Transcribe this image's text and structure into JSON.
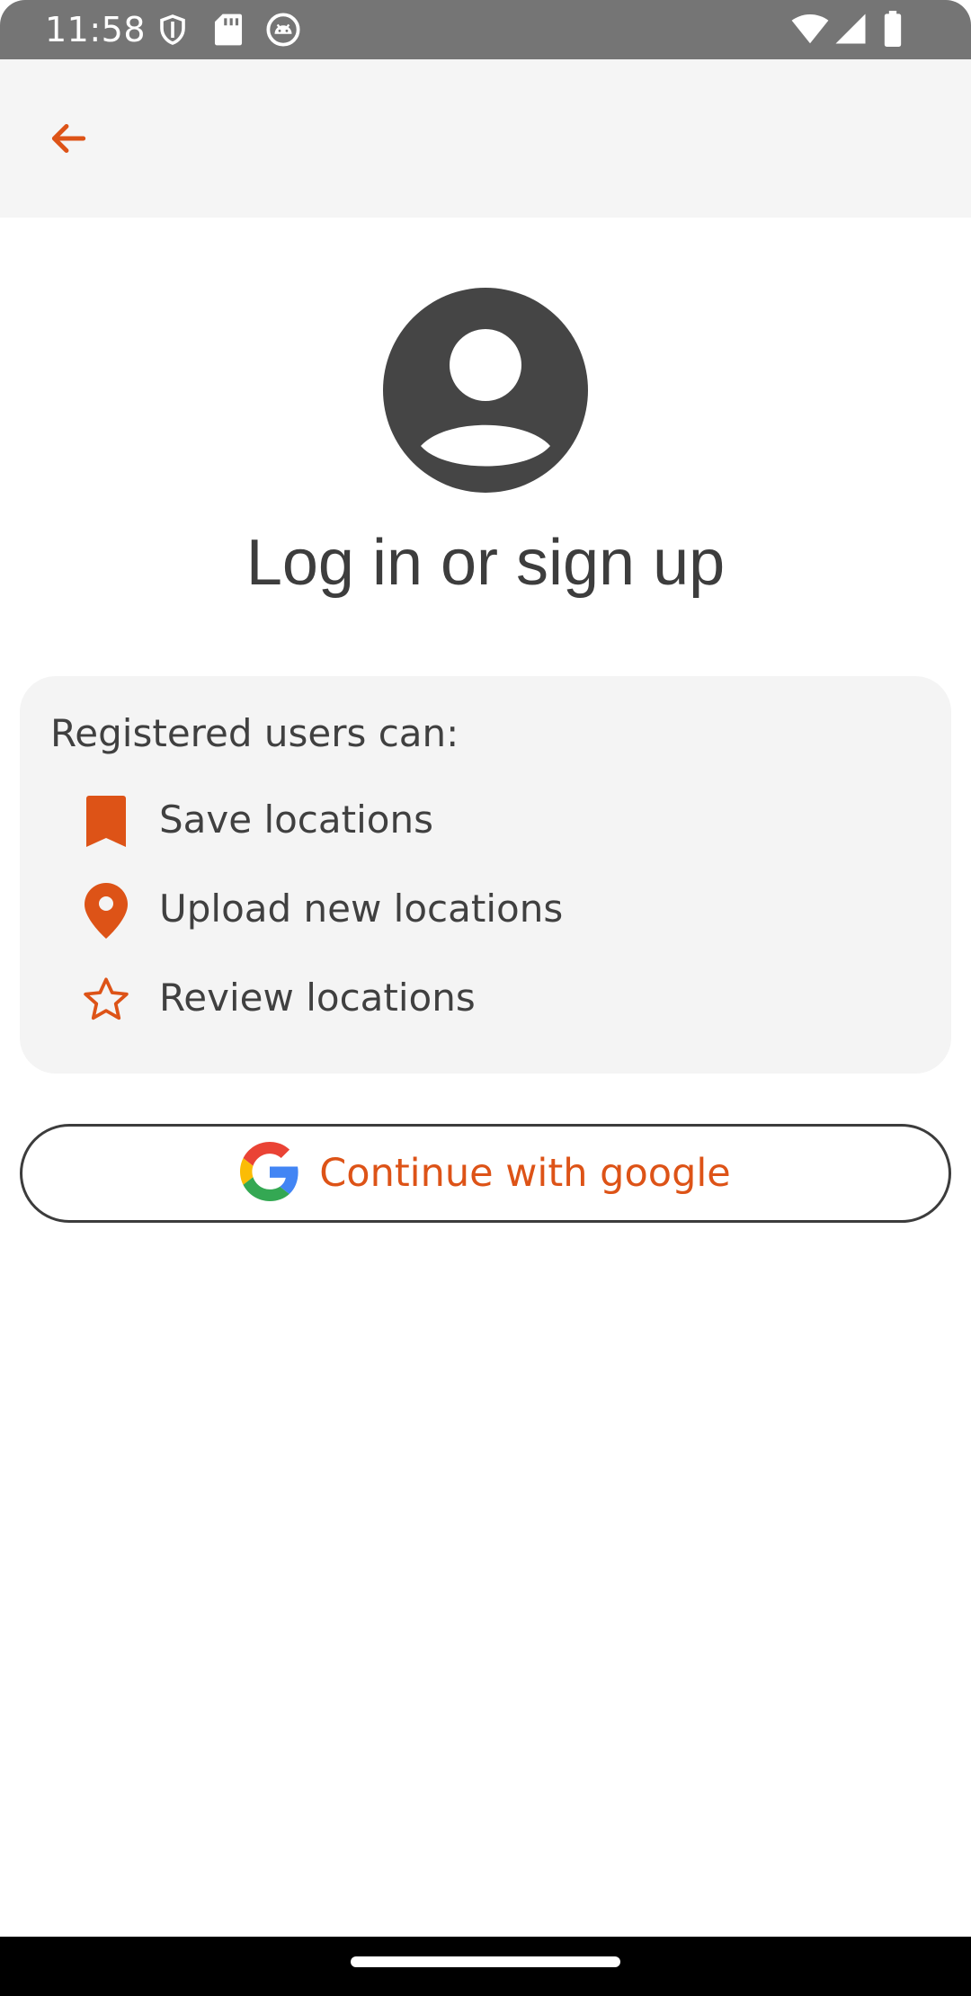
{
  "status_bar": {
    "time": "11:58",
    "icons": [
      "shield-icon",
      "sd-card-icon",
      "android-debug-icon",
      "wifi-icon",
      "signal-icon",
      "battery-icon"
    ]
  },
  "app_bar": {
    "back_icon": "arrow-back-icon"
  },
  "header": {
    "avatar_icon": "account-circle-icon",
    "title": "Log in or sign up"
  },
  "info_card": {
    "heading": "Registered users can:",
    "features": [
      {
        "icon": "bookmark-icon",
        "label": "Save locations"
      },
      {
        "icon": "location-pin-icon",
        "label": "Upload new locations"
      },
      {
        "icon": "star-outline-icon",
        "label": "Review locations"
      }
    ]
  },
  "google_button": {
    "icon": "google-logo-icon",
    "label": "Continue with google"
  },
  "colors": {
    "accent": "#dd5317",
    "title_text": "#3d3d3d",
    "card_background": "#f4f4f4",
    "app_bar_background": "#f5f5f5",
    "status_bar_background": "#757575",
    "avatar": "#454545"
  }
}
